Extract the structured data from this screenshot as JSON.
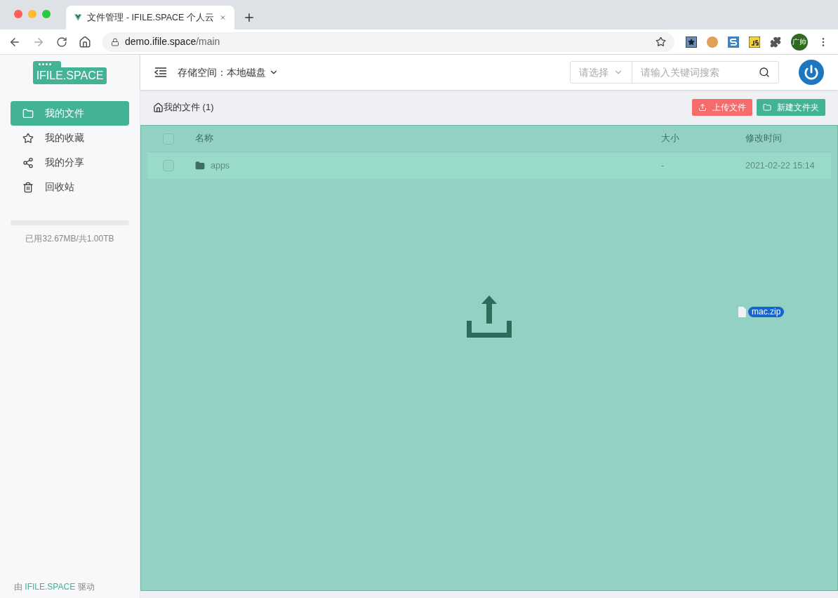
{
  "browser": {
    "tab_title": "文件管理 - IFILE.SPACE 个人云",
    "url_host": "demo.ifile.space",
    "url_path": "/main",
    "profile": "广帅"
  },
  "logo": "IFILE.SPACE",
  "sidebar": {
    "items": [
      {
        "label": "我的文件",
        "selected": true
      },
      {
        "label": "我的收藏",
        "selected": false
      },
      {
        "label": "我的分享",
        "selected": false
      },
      {
        "label": "回收站",
        "selected": false
      }
    ],
    "storage": {
      "text": "已用32.67MB/共1.00TB"
    },
    "footer": {
      "prefix": "由",
      "link": "IFILE.SPACE",
      "suffix": "驱动"
    }
  },
  "header": {
    "storage_label": "存储空间：",
    "storage_value": "本地磁盘",
    "select_placeholder": "请选择",
    "search_placeholder": "请输入关键词搜索"
  },
  "breadcrumb": "我的文件 (1)",
  "buttons": [
    {
      "label": "上传文件",
      "kind": "danger"
    },
    {
      "label": "新建文件夹",
      "kind": "primary"
    }
  ],
  "table": {
    "all_checked": false,
    "columns": [
      "名称",
      "大小",
      "修改时间"
    ],
    "rows": [
      {
        "name": "apps",
        "size": "-",
        "modified": "2021-02-22 15:14",
        "checked": false
      }
    ]
  },
  "drag": {
    "filename": "mac.zip"
  }
}
